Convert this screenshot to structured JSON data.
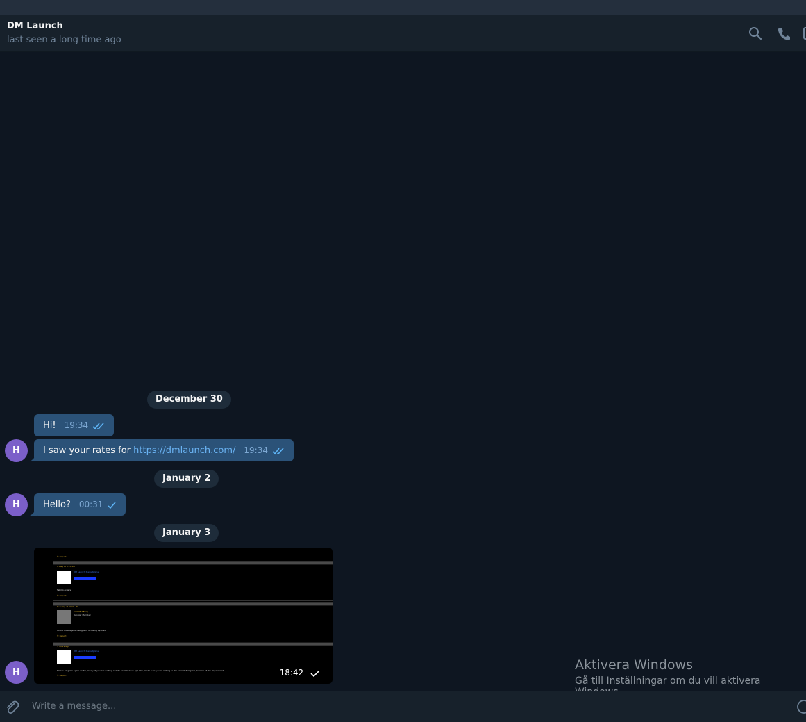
{
  "header": {
    "title": "DM Launch",
    "status": "last seen a long time ago"
  },
  "dates": [
    "December 30",
    "January 2",
    "January 3"
  ],
  "messages": [
    {
      "text": "Hi!",
      "time": "19:34",
      "status": "read"
    },
    {
      "text_prefix": "I saw your rates for ",
      "link": "https://dmlaunch.com/",
      "time": "19:34",
      "status": "read"
    },
    {
      "text": "Hello?",
      "time": "00:31",
      "status": "sent"
    },
    {
      "type": "image",
      "time": "18:42",
      "status": "sent"
    }
  ],
  "avatar": {
    "initial": "H",
    "color": "#7b5fc9"
  },
  "screenshot_contents": {
    "label_report": "⚑ Report",
    "header1": "Friday at 3:21 PM",
    "user1": "DM Launch Marketplace",
    "text1": "Taking orders !",
    "header2": "Tuesday at 10:31 PM",
    "user2": "lotsofantasy",
    "role2": "Regular Member",
    "text2": "I can't message on telegram. Its being ignored!",
    "header3": "5 hours ago",
    "text3": "Please ping me again on TG, many of you are writing and its hard to keep up! Also, make sure you're writing to the correct Telegram, beware of the impersonators!!"
  },
  "input": {
    "placeholder": "Write a message..."
  },
  "watermark": {
    "title": "Aktivera Windows",
    "subtitle": "Gå till Inställningar om du vill aktivera Windows."
  },
  "colors": {
    "background": "#0e1621",
    "header": "#17212b",
    "bubble": "#2b5278",
    "link": "#6ab3f3",
    "date_pill": "#1e2c3a"
  }
}
